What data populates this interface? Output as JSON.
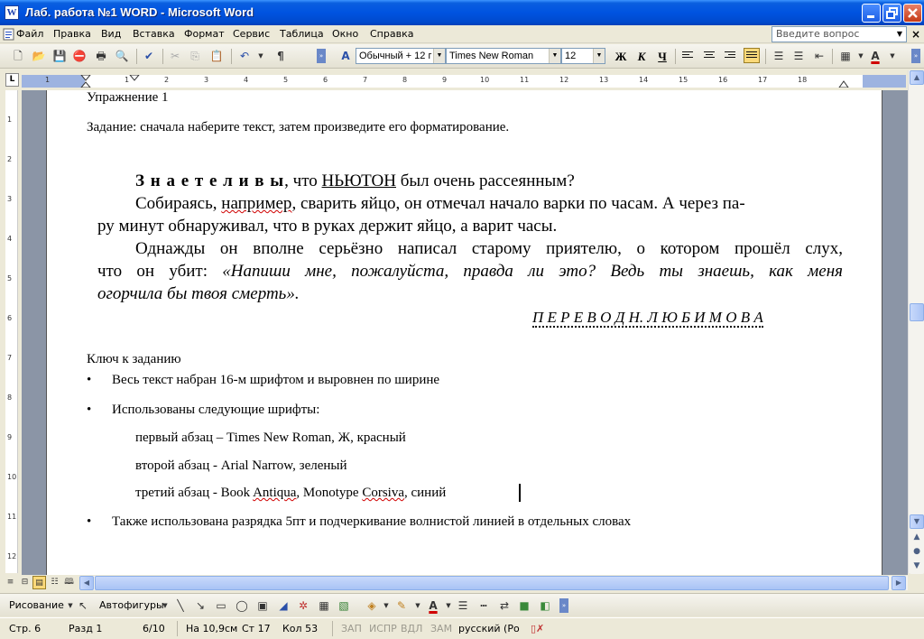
{
  "window": {
    "title": "Лаб. работа №1 WORD - Microsoft Word",
    "app_icon": "W",
    "minimize_icon": "minimize-icon",
    "maximize_icon": "restore-icon",
    "close_icon": "close-icon"
  },
  "menu": {
    "items": [
      "Файл",
      "Правка",
      "Вид",
      "Вставка",
      "Формат",
      "Сервис",
      "Таблица",
      "Окно",
      "Справка"
    ],
    "ask_placeholder": "Введите вопрос",
    "close_glyph": "×"
  },
  "toolbar": {
    "style_value": "Обычный + 12 г",
    "font_value": "Times New Roman",
    "size_value": "12",
    "bold": "Ж",
    "italic": "К",
    "underline": "Ч",
    "font_color_glyph": "A",
    "accent_highlight": "#fbd97a"
  },
  "ruler": {
    "numbers": [
      "1",
      "1",
      "2",
      "3",
      "4",
      "5",
      "6",
      "7",
      "8",
      "9",
      "10",
      "11",
      "12",
      "13",
      "14",
      "15",
      "16",
      "17",
      "18"
    ],
    "vertical_numbers": [
      "1",
      "2",
      "3",
      "4",
      "5",
      "6",
      "7",
      "8",
      "9",
      "10",
      "11",
      "12"
    ],
    "tab_glyph": "L"
  },
  "document": {
    "exercise_title": "Упражнение 1",
    "task_text": "Задание: сначала наберите текст, затем произведите его форматирование.",
    "p1_spaced": "З н а е т е   л и   в ы",
    "p1_rest_a": ", что ",
    "p1_newton": "НЬЮТОН",
    "p1_rest_b": " был очень рассеянным?",
    "p2_line1_a": "Собираясь, ",
    "p2_line1_b": "например",
    "p2_line1_c": ", сварить яйцо, он отмечал начало варки по часам. А через па-",
    "p2_line2": "ру минут обнаруживал, что в руках держит яйцо, а варит часы.",
    "p3_line1": "Однажды он вполне серьёзно написал старому приятелю, о котором прошёл слух,",
    "p3_line2_a": "что он убит: ",
    "p3_line2_b": "«Напиши мне, пожалуйста, правда ли это? Ведь ты знаешь, как меня",
    "p3_line3": "огорчила бы твоя смерть».",
    "translator": "П Е Р Е В О Д   Н.   Л Ю Б И М О В А",
    "key_title": "Ключ к заданию",
    "bullet1": "Весь текст набран 16-м шрифтом и выровнен по ширине",
    "bullet2": "Использованы следующие шрифты:",
    "font_line1": "первый абзац – Times New Roman, Ж, красный",
    "font_line2": "второй абзац - Arial Narrow, зеленый",
    "font_line3_a": "третий абзац - Book ",
    "font_line3_b": "Antiqua",
    "font_line3_c": ", Monotype ",
    "font_line3_d": "Corsiva",
    "font_line3_e": ",  синий",
    "bullet3": "Также использована разрядка 5пт и подчеркивание волнистой линией в отдельных словах",
    "bullet_glyph": "•"
  },
  "drawbar": {
    "drawing_label": "Рисование",
    "autoshapes_label": "Автофигуры"
  },
  "status": {
    "page": "Стр. 6",
    "section": "Разд 1",
    "pages": "6/10",
    "position": "На 10,9см",
    "line": "Ст 17",
    "column": "Кол 53",
    "rec": "ЗАП",
    "trk": "ИСПР",
    "ext": "ВДЛ",
    "ovr": "ЗАМ",
    "language": "русский (Ро"
  }
}
